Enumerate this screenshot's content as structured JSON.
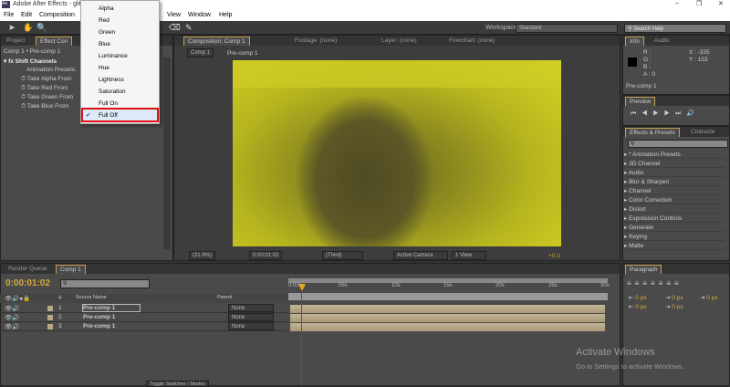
{
  "title": "Adobe After Effects - glit",
  "menu": [
    "File",
    "Edit",
    "Composition",
    "View",
    "Window",
    "Help"
  ],
  "window_controls": [
    "–",
    "❐",
    "✕"
  ],
  "workspace": {
    "label": "Workspace:",
    "value": "Standard"
  },
  "search_help": "Search Help",
  "left_panel": {
    "tabs": [
      "Project",
      "Effect Con"
    ],
    "breadcrumb": "Comp 1 • Pre-comp 1",
    "effect": "Shift Channels",
    "presets_label": "Animation Presets:",
    "properties": [
      "Take Alpha From",
      "Take Red From",
      "Take Green From",
      "Take Blue From"
    ]
  },
  "dropdown": {
    "items": [
      "Alpha",
      "Red",
      "Green",
      "Blue",
      "Luminance",
      "Hue",
      "Lightness",
      "Saturation",
      "Full On",
      "Full Off"
    ],
    "selected": "Full Off"
  },
  "comp_panel": {
    "tabs": [
      "Composition: Comp 1",
      "Footage: (none)",
      "Layer: (none)",
      "Flowchart: (none)"
    ],
    "crumbs": [
      "Comp 1",
      "Pre-comp 1"
    ],
    "zoom": "(31.9%)",
    "time": "0:00:01:02",
    "resolution": "(Third)",
    "camera": "Active Camera",
    "views": "1 View",
    "exposure": "+0.0"
  },
  "info": {
    "tabs": [
      "Info",
      "Audio"
    ],
    "r": "R :",
    "g": "G :",
    "b": "B :",
    "a": "A : 0",
    "x": "X : -335",
    "y": "Y : 153",
    "layer": "Pre-comp 1"
  },
  "preview": {
    "tab": "Preview"
  },
  "effects": {
    "tabs": [
      "Effects & Presets",
      "Characte"
    ],
    "items": [
      "* Animation Presets",
      "3D Channel",
      "Audio",
      "Blur & Sharpen",
      "Channel",
      "Color Correction",
      "Distort",
      "Expression Controls",
      "Generate",
      "Keying",
      "Matte"
    ]
  },
  "timeline": {
    "tabs": [
      "Render Queue",
      "Comp 1"
    ],
    "time": "0:00:01:02",
    "header": {
      "num": "#",
      "source": "Source Name",
      "parent": "Parent"
    },
    "layers": [
      {
        "n": "1",
        "name": "Pre-comp 1",
        "parent": "None"
      },
      {
        "n": "2",
        "name": "Pre-comp 1",
        "parent": "None"
      },
      {
        "n": "3",
        "name": "Pre-comp 1",
        "parent": "None"
      }
    ],
    "ticks": [
      "0:00s",
      "05s",
      "10s",
      "15s",
      "20s",
      "25s",
      "30s"
    ],
    "toggle": "Toggle Switches / Modes"
  },
  "paragraph": {
    "tab": "Paragraph",
    "values": [
      "0 px",
      "0 px",
      "0 px",
      "0 px",
      "0 px"
    ]
  },
  "watermark": {
    "title": "Activate Windows",
    "sub": "Go to Settings to activate Windows."
  },
  "colors": {
    "accent": "#d8a93a",
    "highlight_border": "#d11111",
    "video": "#c8c420"
  }
}
